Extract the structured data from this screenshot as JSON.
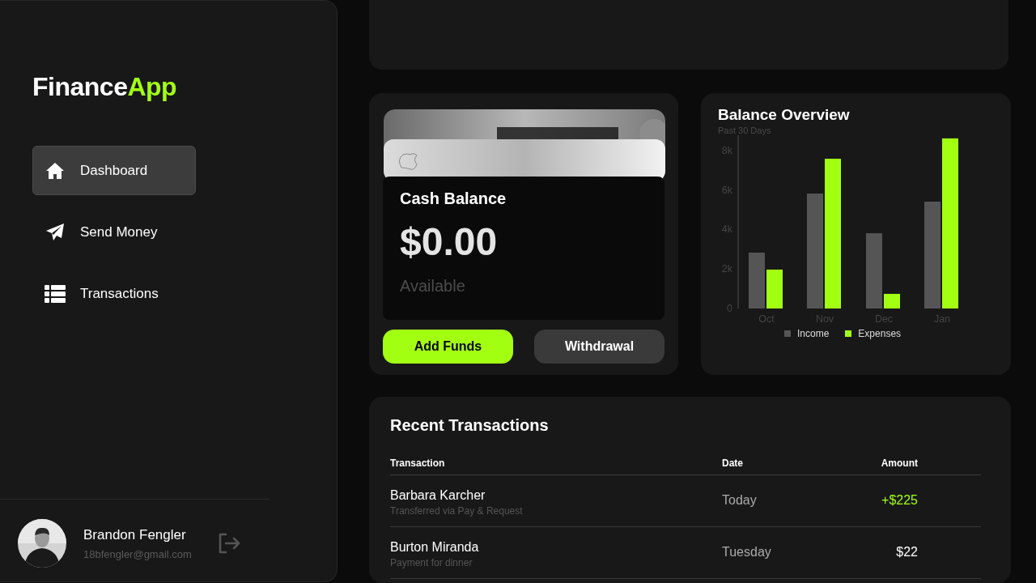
{
  "logo": {
    "text": "Finance",
    "accent": "App"
  },
  "nav": [
    {
      "label": "Dashboard",
      "kind": "home",
      "selected": true
    },
    {
      "label": "Send Money",
      "kind": "send",
      "selected": false
    },
    {
      "label": "Transactions",
      "kind": "list",
      "selected": false
    }
  ],
  "user": {
    "name": "Brandon Fengler",
    "email": "18bfengler@gmail.com"
  },
  "cash_card": {
    "title": "Cash Balance",
    "amount": "$0.00",
    "caption": "Available"
  },
  "actions": [
    {
      "label": "Add Funds",
      "kind": "primary"
    },
    {
      "label": "Withdrawal",
      "kind": "secondary"
    }
  ],
  "balance_overview": {
    "title": "Balance Overview",
    "subtitle": "Past 30 Days",
    "chart_data": {
      "type": "bar",
      "categories": [
        "Oct",
        "Nov",
        "Dec",
        "Jan"
      ],
      "yticks": [
        0,
        {
          "value": 2000,
          "label": "2k"
        },
        {
          "value": 4000,
          "label": "4k"
        },
        {
          "value": 6000,
          "label": "6k"
        },
        {
          "value": 8000,
          "label": "8k"
        }
      ],
      "ylim": [
        0,
        9000
      ],
      "legend": true,
      "series": [
        {
          "name": "Income",
          "color": "#555555",
          "values": [
            2830,
            5820,
            3810,
            5410
          ]
        },
        {
          "name": "Expenses",
          "color": "#a3ff12",
          "values": [
            1970,
            7580,
            740,
            8610
          ]
        }
      ]
    }
  },
  "recent_transactions": {
    "title": "Recent Transactions",
    "columns": [
      "Transaction",
      "Date",
      "Amount"
    ],
    "rows": [
      {
        "name": "Barbara Karcher",
        "note": "Transferred via Pay & Request",
        "date": "Today",
        "amount": "+$225",
        "incoming": true
      },
      {
        "name": "Burton Miranda",
        "note": "Payment for dinner",
        "date": "Tuesday",
        "amount": "$22",
        "incoming": false
      }
    ]
  }
}
